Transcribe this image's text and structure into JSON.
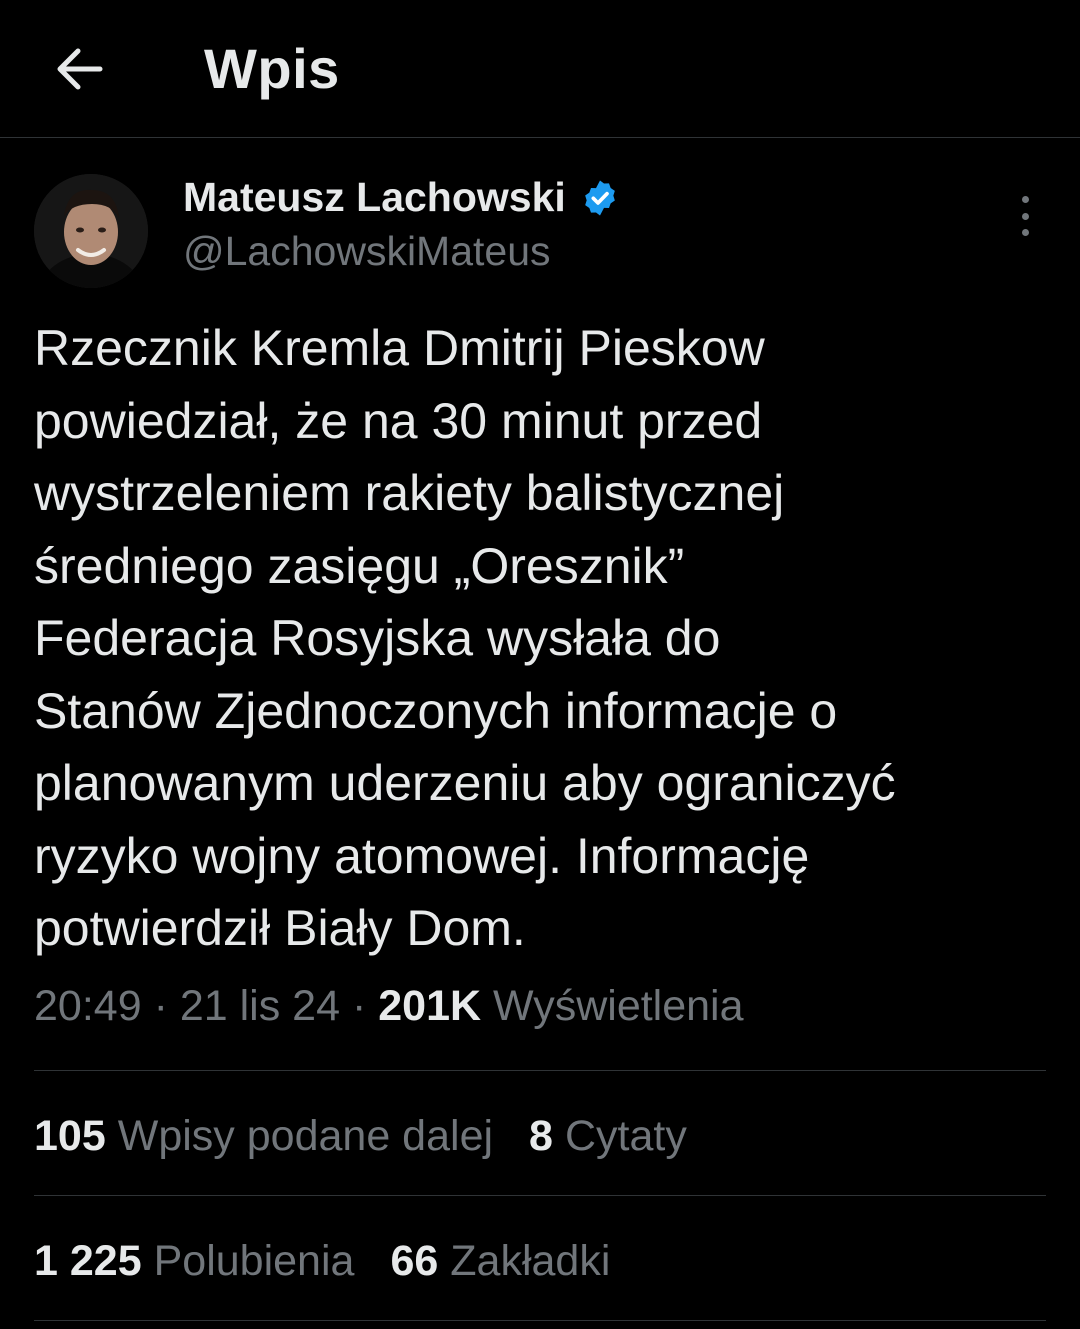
{
  "header": {
    "title": "Wpis",
    "back_icon": "arrow-left-icon"
  },
  "author": {
    "display_name": "Mateusz Lachowski",
    "handle": "@LachowskiMateus",
    "verified_color": "#1d9bf0"
  },
  "tweet": {
    "text": "Rzecznik Kremla Dmitrij Pieskow\npowiedział, że na 30 minut przed\nwystrzeleniem rakiety balistycznej\nśredniego zasięgu „Oresznik”\nFederacja Rosyjska wysłała do\nStanów Zjednoczonych informacje o\nplanowanym uderzeniu aby ograniczyć\nryzyko wojny atomowej. Informację\npotwierdził Biały Dom.",
    "time": "20:49",
    "date": "21 lis 24",
    "views_count": "201K",
    "views_label": "Wyświetlenia"
  },
  "stats": {
    "reposts_count": "105",
    "reposts_label": "Wpisy podane dalej",
    "quotes_count": "8",
    "quotes_label": "Cytaty",
    "likes_count": "1 225",
    "likes_label": "Polubienia",
    "bookmarks_count": "66",
    "bookmarks_label": "Zakładki"
  },
  "colors": {
    "background": "#000000",
    "text": "#e7e9ea",
    "secondary": "#71767b",
    "divider": "#2f3336",
    "accent": "#1d9bf0"
  }
}
